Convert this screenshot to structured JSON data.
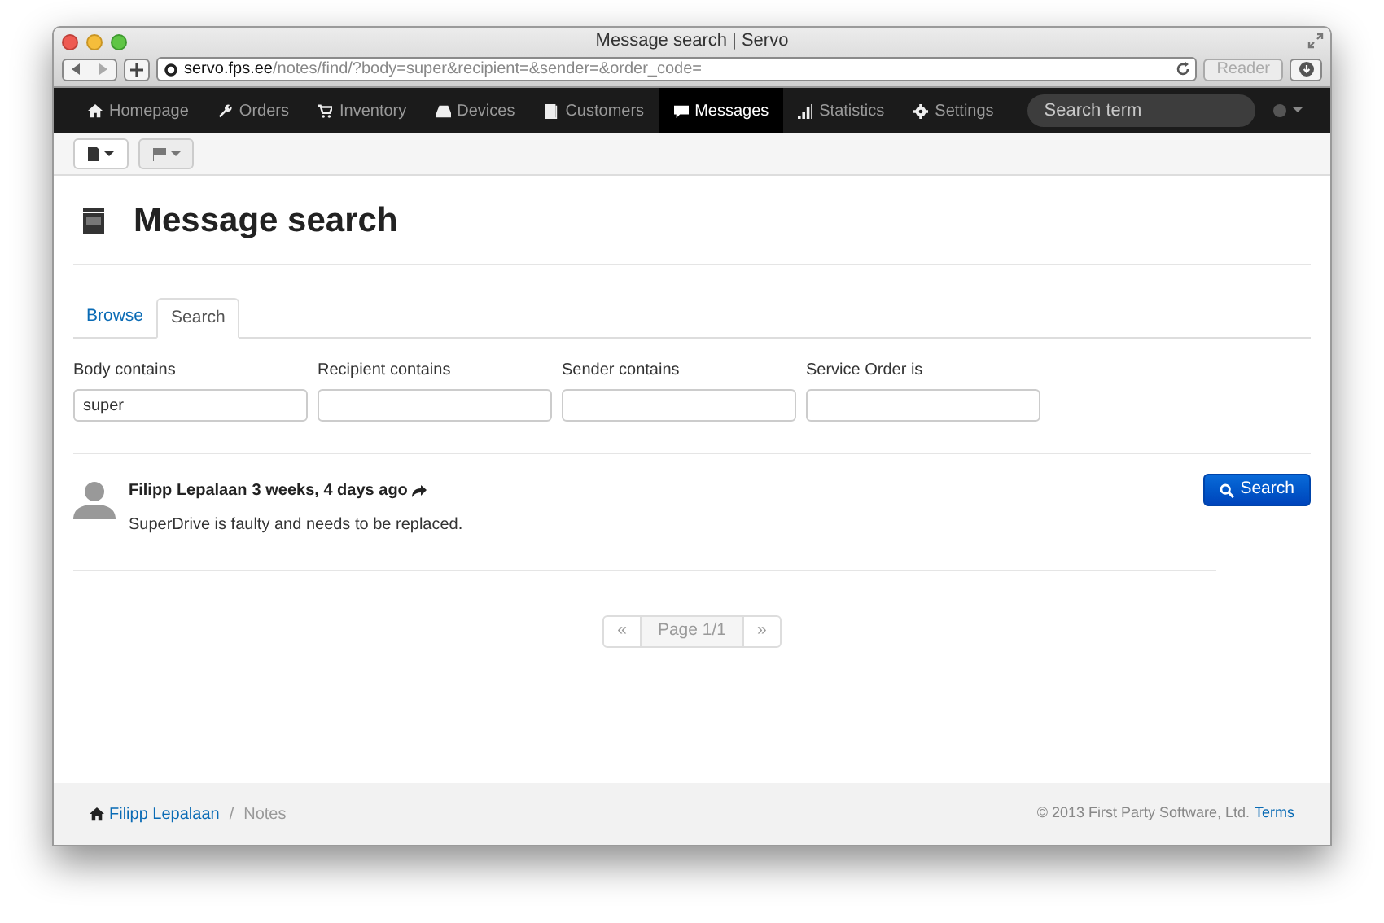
{
  "window": {
    "title": "Message search | Servo"
  },
  "browser": {
    "url_host": "servo.fps.ee",
    "url_path": "/notes/find/?body=super&recipient=&sender=&order_code=",
    "reader": "Reader"
  },
  "nav": {
    "items": [
      {
        "label": "Homepage",
        "selected": false
      },
      {
        "label": "Orders",
        "selected": false
      },
      {
        "label": "Inventory",
        "selected": false
      },
      {
        "label": "Devices",
        "selected": false
      },
      {
        "label": "Customers",
        "selected": false
      },
      {
        "label": "Messages",
        "selected": true
      },
      {
        "label": "Statistics",
        "selected": false
      },
      {
        "label": "Settings",
        "selected": false
      }
    ],
    "search": {
      "placeholder": "Search term"
    }
  },
  "page_title": "Message search",
  "tabs": [
    {
      "label": "Browse",
      "selected": false
    },
    {
      "label": "Search",
      "selected": true
    }
  ],
  "filters": [
    {
      "label": "Body contains",
      "value": "super"
    },
    {
      "label": "Recipient contains"
    },
    {
      "label": "Sender contains"
    },
    {
      "label": "Service Order is"
    }
  ],
  "search_button": "Search",
  "messages": [
    {
      "author": "Filipp Lepalaan",
      "time": "3 weeks, 4 days ago",
      "body": "SuperDrive is faulty and needs to be replaced."
    }
  ],
  "pagination": {
    "prev": "«",
    "page": "Page 1/1",
    "next": "»"
  },
  "footer": {
    "breadcrumb": [
      {
        "label": "Filipp Lepalaan",
        "kind": "link"
      },
      {
        "label": "Notes",
        "kind": "current"
      }
    ],
    "separator": "/",
    "copyright": "© 2013 First Party Software, Ltd.",
    "terms": "Terms"
  }
}
